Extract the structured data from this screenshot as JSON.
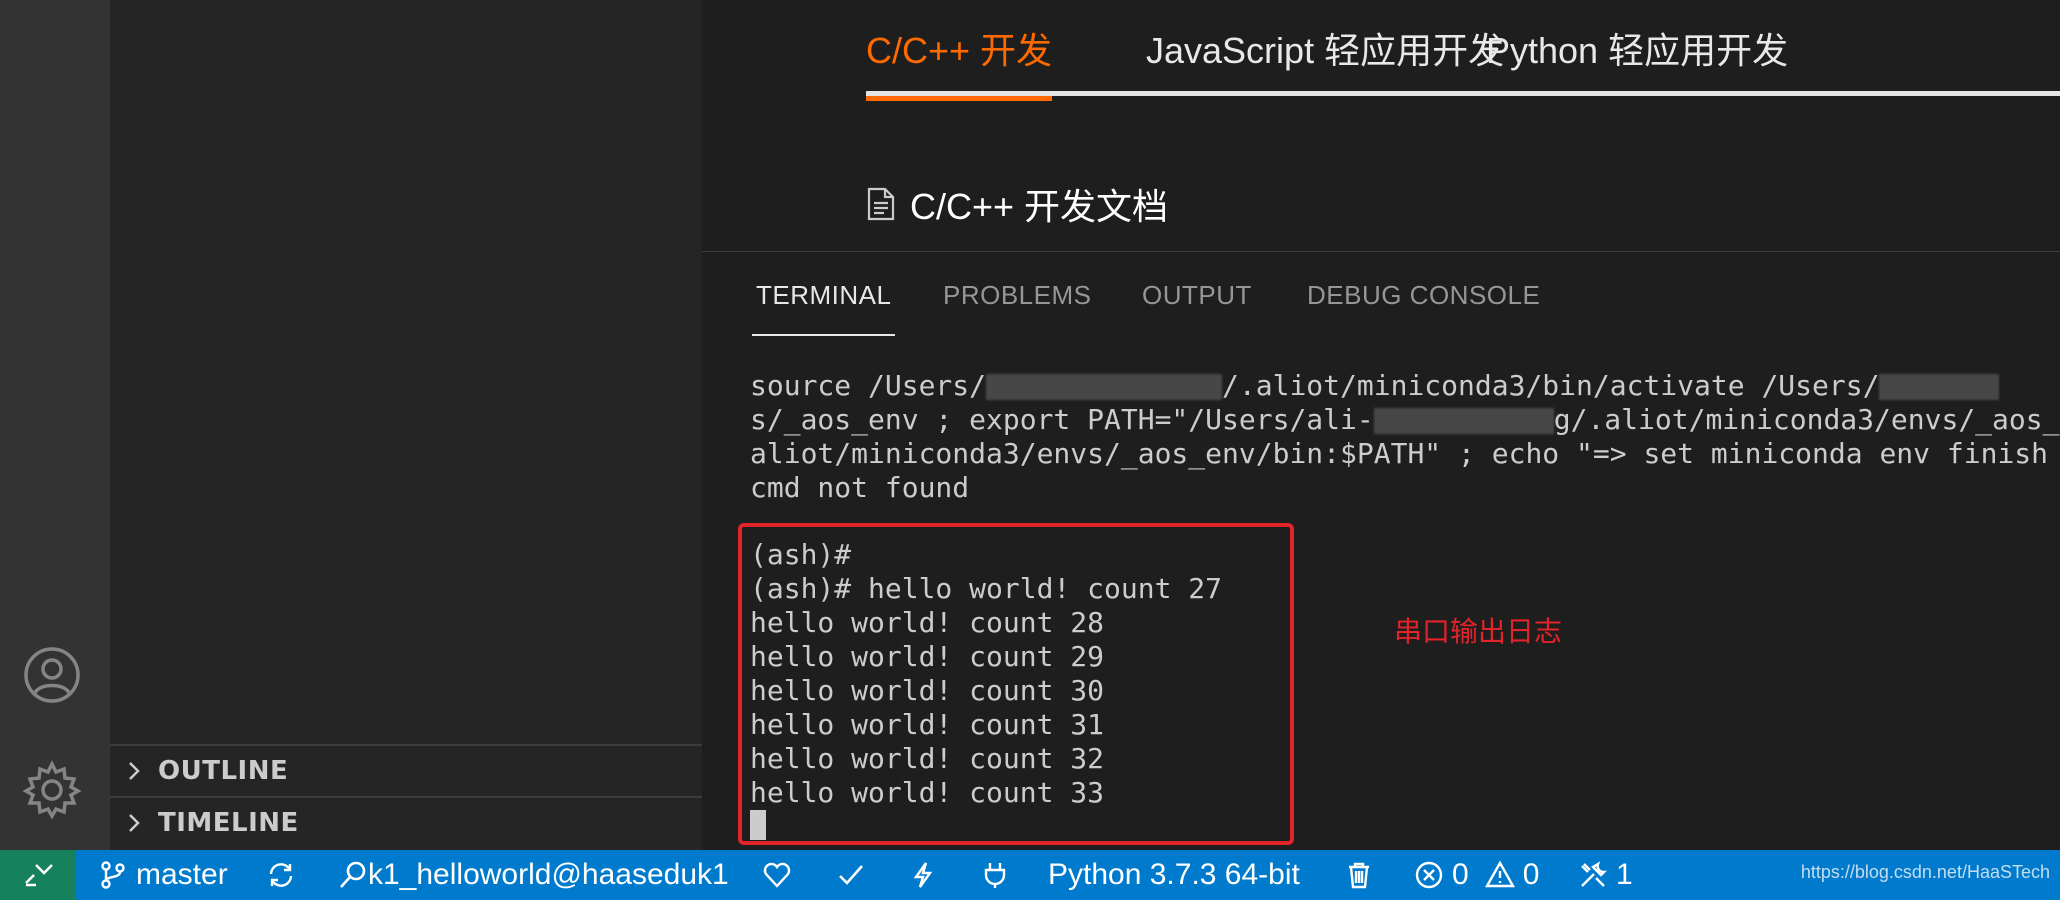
{
  "doc_tabs": [
    {
      "label": "C/C++ 开发",
      "active": true
    },
    {
      "label": "JavaScript 轻应用开发",
      "active": false
    },
    {
      "label": "Python 轻应用开发",
      "active": false
    }
  ],
  "doc_title": "C/C++ 开发文档",
  "sidebar": {
    "sections": [
      "OUTLINE",
      "TIMELINE"
    ]
  },
  "panel": {
    "tabs": [
      "TERMINAL",
      "PROBLEMS",
      "OUTPUT",
      "DEBUG CONSOLE"
    ],
    "active_tab": "TERMINAL"
  },
  "terminal": {
    "line1_a": "source /Users/",
    "line1_b": "/.aliot/miniconda3/bin/activate /Users/",
    "line2_a": "s/_aos_env ; export PATH=\"/Users/ali-",
    "line2_b": "g/.aliot/miniconda3/envs/_aos_",
    "line3": "aliot/miniconda3/envs/_aos_env/bin:$PATH\" ; echo \"=> set miniconda env finish",
    "line4": "cmd not found",
    "log_lines": [
      "(ash)#",
      "(ash)# hello world! count 27",
      "hello world! count 28",
      "hello world! count 29",
      "hello world! count 30",
      "hello world! count 31",
      "hello world! count 32",
      "hello world! count 33"
    ]
  },
  "annotation": "串口输出日志",
  "statusbar": {
    "branch": "master",
    "device": "k1_helloworld@haaseduk1",
    "interpreter": "Python 3.7.3 64-bit",
    "errors": "0",
    "warnings": "0",
    "tools_count": "1",
    "watermark": "https://blog.csdn.net/HaaSTech"
  },
  "colors": {
    "accent_orange": "#ff6a00",
    "statusbar_blue": "#007acc",
    "remote_green": "#16825d",
    "highlight_red": "#e3232a"
  }
}
